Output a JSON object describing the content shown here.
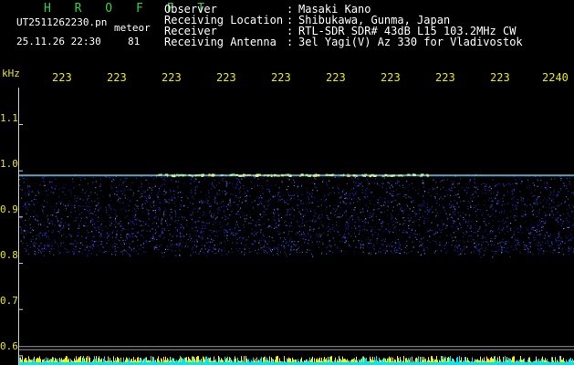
{
  "app": {
    "brand": "H R O F F T",
    "filename": "UT2511262230.pn",
    "mode": "meteor",
    "datetime": "25.11.26 22:30",
    "meteor_count": "81"
  },
  "station": [
    {
      "label": "Observer",
      "value": "Masaki Kano"
    },
    {
      "label": "Receiving Location",
      "value": "Shibukawa, Gunma, Japan"
    },
    {
      "label": "Receiver",
      "value": "RTL-SDR SDR# 43dB L15 103.2MHz CW"
    },
    {
      "label": "Receiving Antenna",
      "value": "3el Yagi(V) Az 330 for Vladivostok"
    }
  ],
  "colors": {
    "text_white": "#ffffff",
    "brand_green": "#2fd24a",
    "tick_yellow": "#e8e800",
    "echo_line": "#7fd6ff",
    "noise_blue": "#2233ff",
    "bottom_bar_cyan": "#00e5ff",
    "bottom_bar_yellow": "#ffee00"
  },
  "chart_data": {
    "type": "heatmap",
    "title": "",
    "xlabel": "",
    "ylabel": "kHz",
    "x_tick_labels": [
      "223",
      "223",
      "223",
      "223",
      "223",
      "223",
      "223",
      "223",
      "223",
      "2240"
    ],
    "y_tick_labels": [
      "1.1",
      "1.0",
      "0.9",
      "0.8",
      "0.7",
      "0.6"
    ],
    "y_ticks_khz": [
      1.1,
      1.0,
      0.9,
      0.8,
      0.7,
      0.6
    ],
    "ylim_khz": [
      0.58,
      1.18
    ],
    "carrier_line_khz": 0.99,
    "noise_band_khz": [
      0.82,
      0.99
    ],
    "reference_lines_khz": [
      0.62,
      0.613
    ]
  }
}
